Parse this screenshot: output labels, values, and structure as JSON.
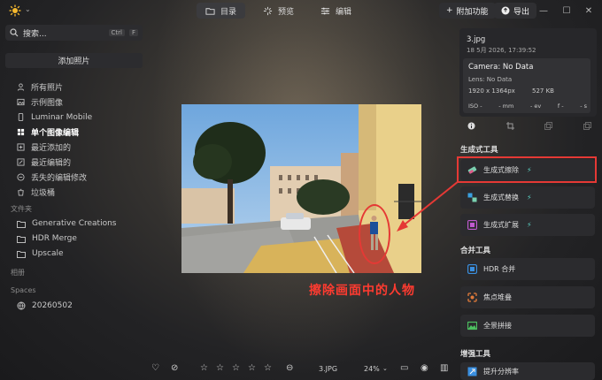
{
  "topbar": {
    "nav": [
      {
        "label": "目录",
        "icon": "folder-icon",
        "active": true
      },
      {
        "label": "预览",
        "icon": "sparkle-icon",
        "active": false
      },
      {
        "label": "编辑",
        "icon": "sliders-icon",
        "active": false
      }
    ],
    "addon_label": "附加功能",
    "export_label": "导出",
    "window_controls": [
      "minimize",
      "maximize",
      "close"
    ]
  },
  "sidebar": {
    "search_placeholder": "搜索...",
    "search_kbd1": "Ctrl",
    "search_kbd2": "F",
    "add_photos": "添加照片",
    "items": [
      {
        "label": "所有照片",
        "icon": "person-icon"
      },
      {
        "label": "示例图像",
        "icon": "image-icon"
      },
      {
        "label": "Luminar Mobile",
        "icon": "phone-icon"
      },
      {
        "label": "单个图像编辑",
        "icon": "grid-icon",
        "selected": true
      },
      {
        "label": "最近添加的",
        "icon": "plus-box-icon"
      },
      {
        "label": "最近编辑的",
        "icon": "edit-box-icon"
      },
      {
        "label": "丢失的编辑修改",
        "icon": "trash-restore-icon"
      },
      {
        "label": "垃圾桶",
        "icon": "trash-icon"
      }
    ],
    "folders_label": "文件夹",
    "folders": [
      "Generative Creations",
      "HDR Merge",
      "Upscale"
    ],
    "albums_label": "相册",
    "spaces_label": "Spaces",
    "spaces": [
      "20260502"
    ]
  },
  "canvas": {
    "annotation_text": "擦除画面中的人物",
    "annotation_color": "#ff3b30"
  },
  "bottombar": {
    "filename": "3.JPG",
    "zoom": "24%",
    "stars": 5
  },
  "info": {
    "filename": "3.jpg",
    "date": "18 5月 2026, 17:39:52",
    "camera": "Camera: No Data",
    "lens": "Lens: No Data",
    "dimensions": "1920 x 1364px",
    "size": "527 KB",
    "iso": "ISO -",
    "focal": "- mm",
    "ev": "- ev",
    "aperture": "f -",
    "shutter": "- s"
  },
  "tools": {
    "genai_label": "生成式工具",
    "genai": [
      {
        "label": "生成式擦除",
        "icon": "eraser-icon",
        "color": "#e05a8a"
      },
      {
        "label": "生成式替换",
        "icon": "swap-icon",
        "color": "#3aa0e0"
      },
      {
        "label": "生成式扩展",
        "icon": "expand-icon",
        "color": "#c05ad0"
      }
    ],
    "merge_label": "合并工具",
    "merge": [
      {
        "label": "HDR 合并",
        "icon": "hdr-icon",
        "color": "#3a8fe0"
      },
      {
        "label": "焦点堆叠",
        "icon": "focus-icon",
        "color": "#e07a3a"
      },
      {
        "label": "全景拼接",
        "icon": "panorama-icon",
        "color": "#4cc060"
      }
    ],
    "enhance_label": "增强工具",
    "enhance": [
      {
        "label": "提升分辨率",
        "icon": "upscale-icon",
        "color": "#3a8fe0"
      }
    ],
    "spark_glyph": "⚡"
  }
}
